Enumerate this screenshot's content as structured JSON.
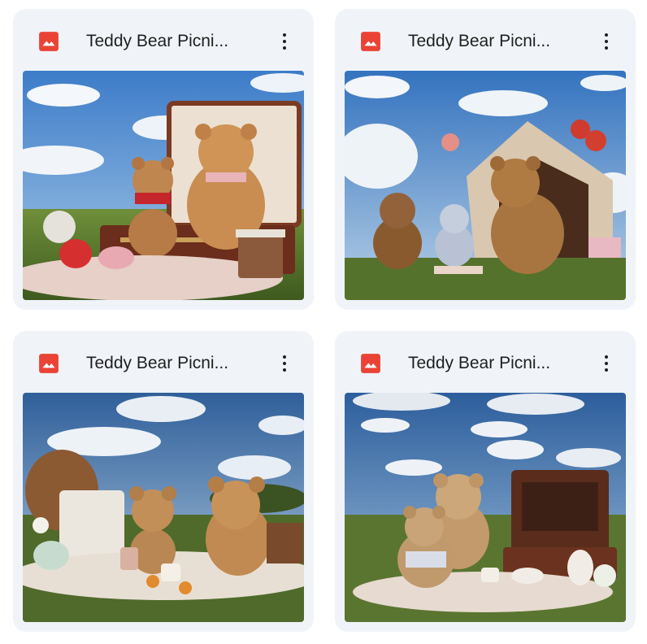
{
  "files": [
    {
      "title": "Teddy Bear Picni...",
      "type_icon": "image-file-icon",
      "menu_icon": "more-vert-icon"
    },
    {
      "title": "Teddy Bear Picni...",
      "type_icon": "image-file-icon",
      "menu_icon": "more-vert-icon"
    },
    {
      "title": "Teddy Bear Picni...",
      "type_icon": "image-file-icon",
      "menu_icon": "more-vert-icon"
    },
    {
      "title": "Teddy Bear Picni...",
      "type_icon": "image-file-icon",
      "menu_icon": "more-vert-icon"
    }
  ],
  "colors": {
    "card_bg": "#f0f4f9",
    "image_icon": "#ea4335",
    "title_text": "#1f1f1f"
  }
}
